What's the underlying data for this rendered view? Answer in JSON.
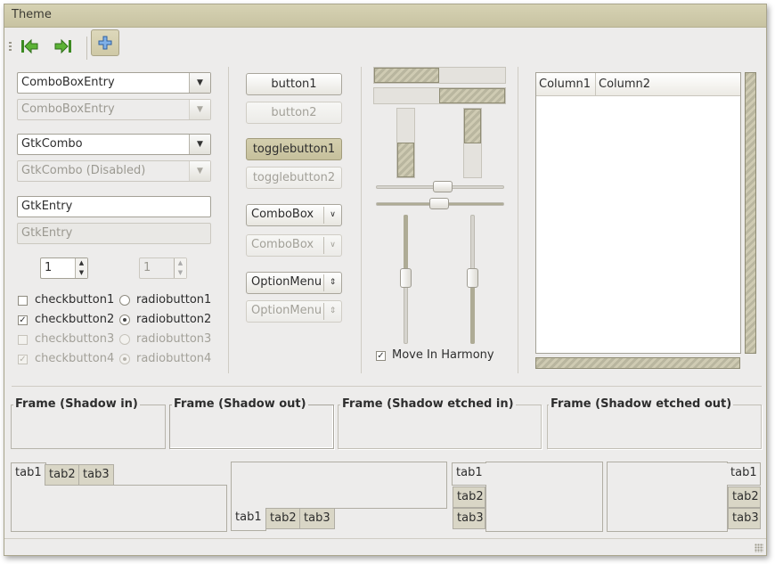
{
  "window": {
    "title": "Theme"
  },
  "toolbar": {
    "buttons": [
      {
        "name": "go-first-icon"
      },
      {
        "name": "go-last-icon"
      },
      {
        "name": "add-icon",
        "active": true
      }
    ]
  },
  "column1": {
    "combobox_entry": "ComboBoxEntry",
    "combobox_entry_disabled": "ComboBoxEntry",
    "gtkcombo": "GtkCombo",
    "gtkcombo_disabled": "GtkCombo (Disabled)",
    "entry": "GtkEntry",
    "entry_disabled": "GtkEntry",
    "spin_value": "1",
    "spin_disabled_value": "1",
    "checkbuttons": [
      {
        "label": "checkbutton1",
        "checked": false,
        "disabled": false
      },
      {
        "label": "checkbutton2",
        "checked": true,
        "disabled": false
      },
      {
        "label": "checkbutton3",
        "checked": false,
        "disabled": true
      },
      {
        "label": "checkbutton4",
        "checked": true,
        "disabled": true
      }
    ],
    "radiobuttons": [
      {
        "label": "radiobutton1",
        "checked": false,
        "disabled": false
      },
      {
        "label": "radiobutton2",
        "checked": true,
        "disabled": false
      },
      {
        "label": "radiobutton3",
        "checked": false,
        "disabled": true
      },
      {
        "label": "radiobutton4",
        "checked": true,
        "disabled": true
      }
    ]
  },
  "column2": {
    "button1": "button1",
    "button2": "button2",
    "togglebutton1": "togglebutton1",
    "togglebutton2": "togglebutton2",
    "combobox": "ComboBox",
    "combobox_disabled": "ComboBox",
    "optionmenu": "OptionMenu",
    "optionmenu_disabled": "OptionMenu"
  },
  "column3": {
    "move_in_harmony": "Move In Harmony",
    "move_in_harmony_checked": true
  },
  "tree": {
    "columns": [
      "Column1",
      "Column2"
    ]
  },
  "frames": [
    "Frame (Shadow in)",
    "Frame (Shadow out)",
    "Frame (Shadow etched in)",
    "Frame (Shadow etched out)"
  ],
  "notebooks": {
    "tabs": [
      "tab1",
      "tab2",
      "tab3"
    ]
  },
  "colors": {
    "accent": "#c9c3a1",
    "window_bg": "#edeceb",
    "titlebar": "#d0cbab"
  }
}
